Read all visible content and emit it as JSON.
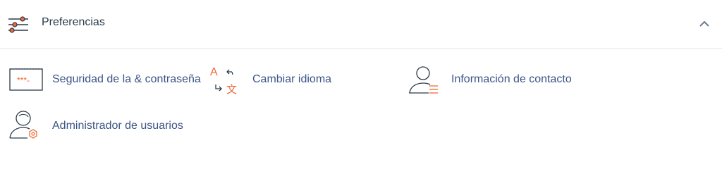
{
  "section": {
    "title": "Preferencias",
    "header_icon": "sliders-icon",
    "collapse_icon": "chevron-up-icon"
  },
  "tools": [
    {
      "label": "Seguridad de la & contraseña",
      "icon": "password-security-icon"
    },
    {
      "label": "Cambiar idioma",
      "icon": "translate-icon"
    },
    {
      "label": "Información de contacto",
      "icon": "contact-info-icon"
    },
    {
      "label": "Administrador de usuarios",
      "icon": "user-manager-icon"
    }
  ],
  "colors": {
    "accent": "#f06a35",
    "icon_dark": "#293a4a",
    "link": "#3b5486",
    "divider": "#e6e8ec"
  }
}
